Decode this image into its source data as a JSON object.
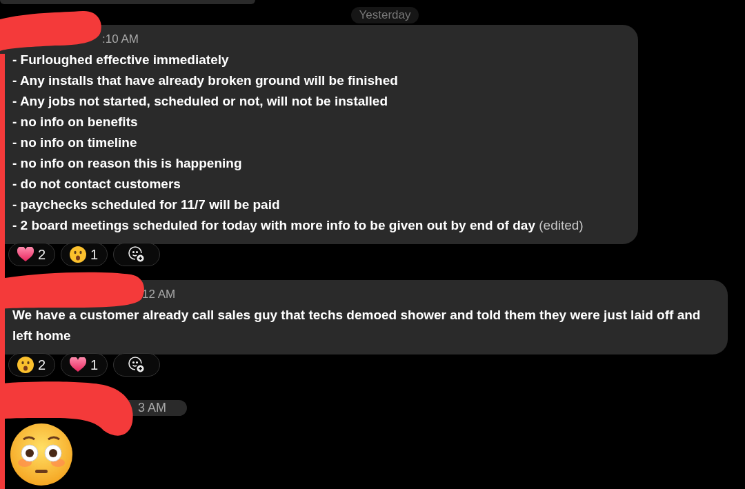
{
  "date_divider": "Yesterday",
  "messages": [
    {
      "kind": "text",
      "time": ":10 AM",
      "lines": [
        "- Furloughed effective immediately",
        "- Any installs that have already broken ground will be finished",
        "- Any jobs not started, scheduled or not, will not be installed",
        "- no info on benefits",
        "- no info on timeline",
        "- no info on reason this is happening",
        "- do not contact customers",
        "- paychecks scheduled for 11/7 will be paid",
        "- 2 board meetings scheduled for today with more info to be given out by end of day"
      ],
      "edited": "(edited)",
      "reactions": [
        {
          "kind": "heart",
          "count": "2"
        },
        {
          "kind": "surprised",
          "count": "1"
        }
      ]
    },
    {
      "kind": "text",
      "time": "12 AM",
      "lines": [
        "We have a customer already call sales guy that techs demoed shower and told them they were just laid off and left home"
      ],
      "reactions": [
        {
          "kind": "surprised",
          "count": "2"
        },
        {
          "kind": "heart",
          "count": "1"
        }
      ]
    },
    {
      "kind": "emoji",
      "time": "3 AM"
    }
  ]
}
